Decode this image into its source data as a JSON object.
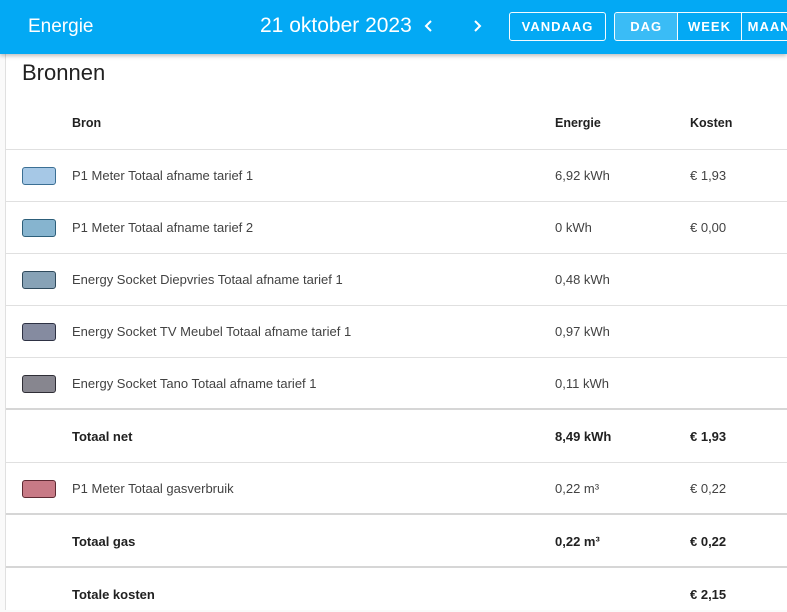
{
  "header": {
    "app_title": "Energie",
    "date": "21 oktober 2023",
    "today_label": "VANDAAG",
    "periods": [
      {
        "label": "DAG",
        "active": true
      },
      {
        "label": "WEEK",
        "active": false
      },
      {
        "label": "MAAN",
        "active": false
      }
    ],
    "accent_color": "#03a9f4"
  },
  "card": {
    "title": "Bronnen",
    "columns": {
      "source": "Bron",
      "energy": "Energie",
      "cost": "Kosten"
    },
    "rows": [
      {
        "name": "P1 Meter Totaal afname tarief 1",
        "energy": "6,92 kWh",
        "cost": "€ 1,93",
        "color": "#a6c8e6",
        "border": "#3b6f94"
      },
      {
        "name": "P1 Meter Totaal afname tarief 2",
        "energy": "0 kWh",
        "cost": "€ 0,00",
        "color": "#86b4cf",
        "border": "#2d5f7a"
      },
      {
        "name": "Energy Socket Diepvries Totaal afname tarief 1",
        "energy": "0,48 kWh",
        "cost": "",
        "color": "#87a2b6",
        "border": "#2f4a5c"
      },
      {
        "name": "Energy Socket TV Meubel Totaal afname tarief 1",
        "energy": "0,97 kWh",
        "cost": "",
        "color": "#858ba0",
        "border": "#2e3244"
      },
      {
        "name": "Energy Socket Tano Totaal afname tarief 1",
        "energy": "0,11 kWh",
        "cost": "",
        "color": "#87868f",
        "border": "#2f2e36"
      }
    ],
    "total_net": {
      "name": "Totaal net",
      "energy": "8,49 kWh",
      "cost": "€ 1,93"
    },
    "gas_row": {
      "name": "P1 Meter Totaal gasverbruik",
      "energy": "0,22 m³",
      "cost": "€ 0,22",
      "color": "#c87a86",
      "border": "#5e2a33"
    },
    "total_gas": {
      "name": "Totaal gas",
      "energy": "0,22 m³",
      "cost": "€ 0,22"
    },
    "total_cost": {
      "name": "Totale kosten",
      "energy": "",
      "cost": "€ 2,15"
    }
  }
}
